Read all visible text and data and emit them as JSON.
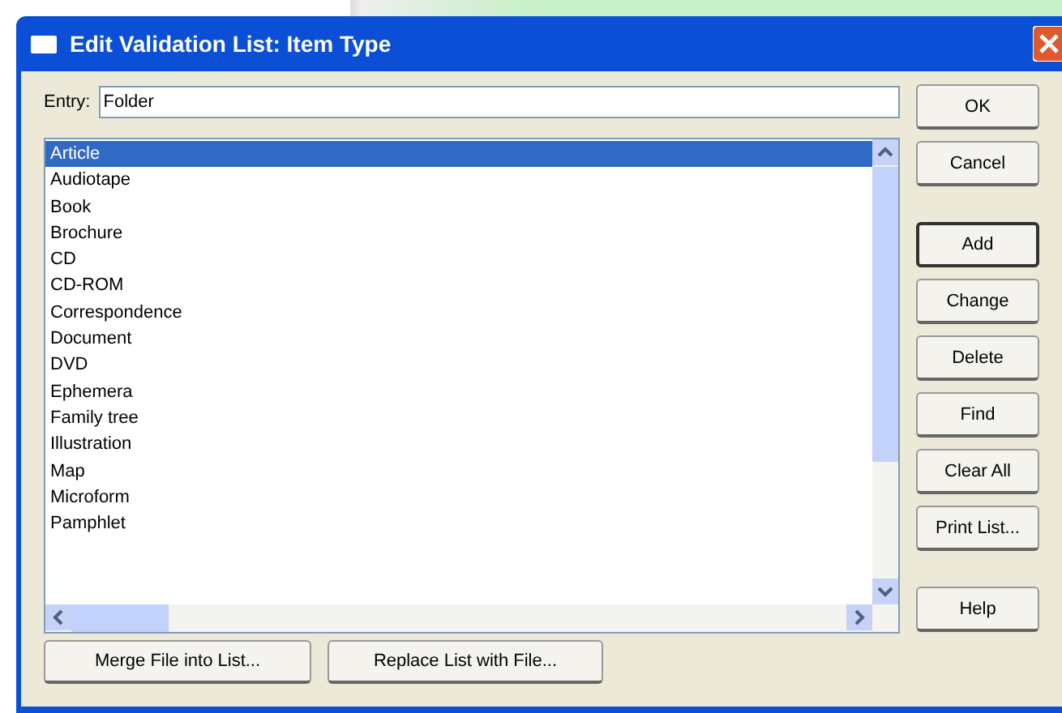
{
  "window": {
    "title": "Edit Validation List: Item Type"
  },
  "entry": {
    "label": "Entry:",
    "value": "Folder"
  },
  "list": {
    "items": [
      {
        "label": "Article",
        "selected": true
      },
      {
        "label": "Audiotape",
        "selected": false
      },
      {
        "label": "Book",
        "selected": false
      },
      {
        "label": "Brochure",
        "selected": false
      },
      {
        "label": "CD",
        "selected": false
      },
      {
        "label": "CD-ROM",
        "selected": false
      },
      {
        "label": "Correspondence",
        "selected": false
      },
      {
        "label": "Document",
        "selected": false
      },
      {
        "label": "DVD",
        "selected": false
      },
      {
        "label": "Ephemera",
        "selected": false
      },
      {
        "label": "Family tree",
        "selected": false
      },
      {
        "label": "Illustration",
        "selected": false
      },
      {
        "label": "Map",
        "selected": false
      },
      {
        "label": "Microform",
        "selected": false
      },
      {
        "label": "Pamphlet",
        "selected": false
      }
    ]
  },
  "side_button_groups": [
    [
      {
        "label": "OK",
        "default": false
      },
      {
        "label": "Cancel",
        "default": false
      }
    ],
    [
      {
        "label": "Add",
        "default": true
      },
      {
        "label": "Change",
        "default": false
      },
      {
        "label": "Delete",
        "default": false
      },
      {
        "label": "Find",
        "default": false
      },
      {
        "label": "Clear All",
        "default": false
      },
      {
        "label": "Print List...",
        "default": false
      }
    ],
    [
      {
        "label": "Help",
        "default": false
      }
    ]
  ],
  "bottom_buttons": [
    "Merge File into List...",
    "Replace List with File..."
  ]
}
